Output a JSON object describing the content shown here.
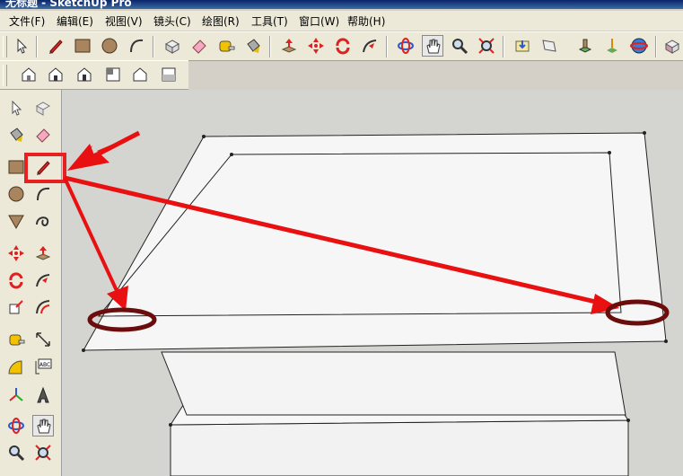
{
  "window": {
    "title": "无标题 - SketchUp Pro"
  },
  "menu": [
    "文件(F)",
    "编辑(E)",
    "视图(V)",
    "镜头(C)",
    "绘图(R)",
    "工具(T)",
    "窗口(W)",
    "帮助(H)"
  ],
  "toolbar_main": {
    "icons": [
      "select-icon",
      "pencil-icon",
      "rectangle-icon",
      "circle-icon",
      "arc-icon",
      "make-component-icon",
      "eraser-icon",
      "tape-measure-icon",
      "paint-bucket-icon",
      "push-pull-icon",
      "move-icon",
      "rotate-icon",
      "follow-me-icon",
      "orbit-icon",
      "pan-icon",
      "zoom-icon",
      "zoom-extents-icon",
      "get-models-icon",
      "share-model-icon",
      "place-model-icon",
      "add-location-icon",
      "google-earth-icon",
      "component-icon"
    ]
  },
  "toolbar_views": {
    "icons": [
      "iso-view-icon",
      "top-view-icon",
      "front-view-icon",
      "right-view-icon",
      "back-view-icon",
      "left-view-icon"
    ]
  },
  "left_toolbar": {
    "icons": [
      "select-icon",
      "component-icon",
      "paint-bucket-icon",
      "eraser-icon",
      "rectangle-icon",
      "pencil-icon",
      "circle-icon",
      "arc-icon",
      "polygon-icon",
      "freehand-icon",
      "move-icon",
      "push-pull-icon",
      "rotate-icon",
      "follow-me-icon",
      "scale-icon",
      "offset-icon",
      "tape-measure-icon",
      "dimension-icon",
      "protractor-icon",
      "text-icon",
      "axes-icon",
      "3d-text-icon",
      "orbit-icon",
      "pan-icon",
      "zoom-icon",
      "zoom-extents-icon"
    ],
    "highlighted": "pencil-icon",
    "text_icon_label": "ABC"
  },
  "colors": {
    "annotation_red": "#e81010",
    "highlight_box": "#e82020",
    "ellipse": "#6b0d0d",
    "viewport_bg": "#d4d4d0",
    "model_face": "#f4f4f4"
  }
}
